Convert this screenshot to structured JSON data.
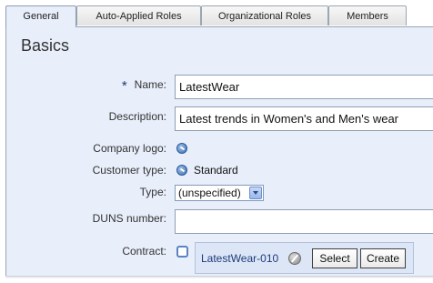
{
  "tabs": [
    {
      "label": "General"
    },
    {
      "label": "Auto-Applied Roles"
    },
    {
      "label": "Organizational Roles"
    },
    {
      "label": "Members"
    }
  ],
  "section_title": "Basics",
  "fields": {
    "name": {
      "required_marker": "*",
      "label": "Name:",
      "value": "LatestWear"
    },
    "description": {
      "label": "Description:",
      "value": "Latest trends in Women's and Men's wear"
    },
    "company_logo": {
      "label": "Company logo:"
    },
    "customer_type": {
      "label": "Customer type:",
      "value": "Standard"
    },
    "type": {
      "label": "Type:",
      "value": "(unspecified)"
    },
    "duns": {
      "label": "DUNS number:",
      "value": ""
    },
    "contract": {
      "label": "Contract:",
      "value": "LatestWear-010",
      "select_label": "Select",
      "create_label": "Create"
    }
  },
  "icons": {
    "logo_picker": "blue-arrow-circle-icon",
    "customer_type_picker": "blue-arrow-circle-icon",
    "contract_toggle": "checkbox-icon",
    "contract_edit": "pencil-icon"
  },
  "colors": {
    "panel_bg": "#e8eefa",
    "link": "#1d3b7a",
    "required": "#203a78"
  }
}
